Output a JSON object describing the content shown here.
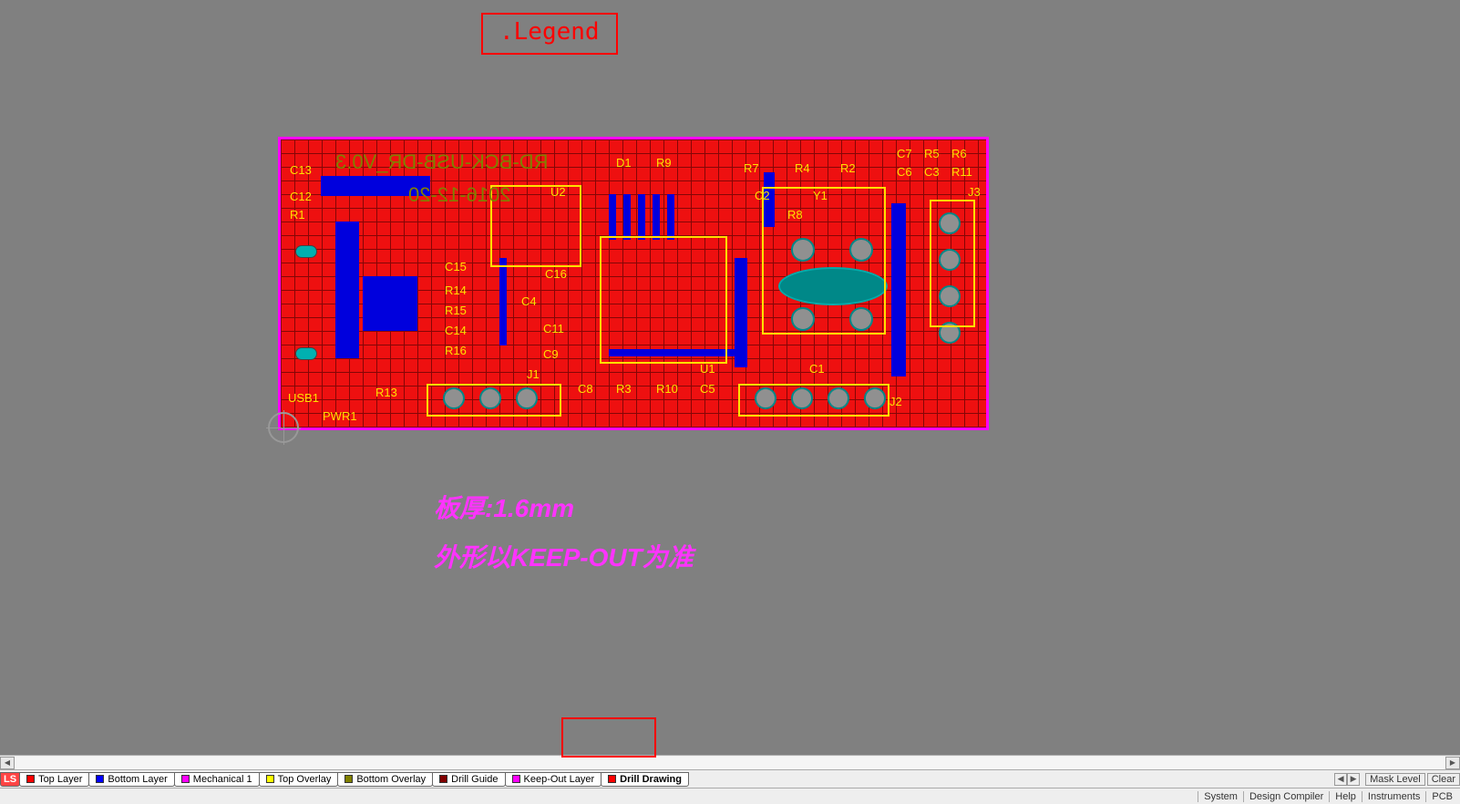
{
  "legend": ".Legend",
  "annotations": {
    "thickness": "板厚:1.6mm",
    "outline": "外形以KEEP-OUT为准"
  },
  "silkscreen_olive": {
    "title": "RD-BCK-USB-DR_V0.3",
    "date": "2016-12-20"
  },
  "refs": {
    "c13": "C13",
    "c12": "C12",
    "r1": "R1",
    "usb1": "USB1",
    "pwr1": "PWR1",
    "r13": "R13",
    "c15": "C15",
    "r14": "R14",
    "r15": "R15",
    "c14": "C14",
    "r16": "R16",
    "c16": "C16",
    "c4": "C4",
    "c11": "C11",
    "c9": "C9",
    "j1": "J1",
    "c8": "C8",
    "r3": "R3",
    "r10": "R10",
    "c5": "C5",
    "u2": "U2",
    "u1": "U1",
    "d1": "D1",
    "r9": "R9",
    "r7": "R7",
    "r4": "R4",
    "r2": "R2",
    "c2": "C2",
    "y1": "Y1",
    "r8": "R8",
    "c1": "C1",
    "c7": "C7",
    "r5": "R5",
    "r6": "R6",
    "c6": "C6",
    "c3": "C3",
    "r11": "R11",
    "j2": "J2",
    "j3": "J3"
  },
  "layer_tabs": {
    "ls": "LS",
    "top_layer": "Top Layer",
    "bottom_layer": "Bottom Layer",
    "mechanical_1": "Mechanical 1",
    "top_overlay": "Top Overlay",
    "bottom_overlay": "Bottom Overlay",
    "drill_guide": "Drill Guide",
    "keep_out": "Keep-Out Layer",
    "drill_drawing": "Drill Drawing"
  },
  "mask": {
    "label": "Mask Level",
    "clear": "Clear"
  },
  "status": {
    "system": "System",
    "design_compiler": "Design Compiler",
    "help": "Help",
    "instruments": "Instruments",
    "pcb": "PCB"
  }
}
